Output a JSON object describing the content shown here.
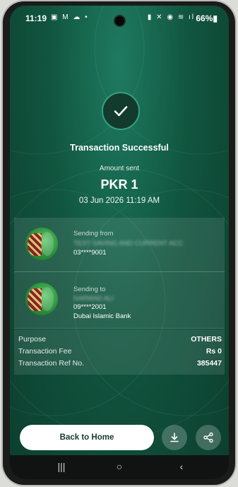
{
  "status_bar": {
    "time": "11:19",
    "left_icons": "▣ M ☁ •",
    "right_icons": "▮ ✕ ◉ ≋ ıl",
    "battery": "66%▮"
  },
  "header": {
    "title": "Transaction Successful",
    "amount_label": "Amount sent",
    "amount": "PKR 1",
    "datetime": "03 Jun 2026 11:19 AM"
  },
  "sender": {
    "label": "Sending from",
    "name": "TEST SAVING AND CURRENT ACC",
    "account": "03****9001"
  },
  "recipient": {
    "label": "Sending to",
    "name": "SARMAD ALI",
    "account": "09****2001",
    "bank": "Dubai Islamic Bank"
  },
  "details": [
    {
      "label": "Purpose",
      "value": "OTHERS"
    },
    {
      "label": "Transaction Fee",
      "value": "Rs 0"
    },
    {
      "label": "Transaction Ref No.",
      "value": "385447"
    }
  ],
  "actions": {
    "home_label": "Back to Home",
    "download_icon": "download-icon",
    "share_icon": "share-icon"
  },
  "nav": {
    "recents": "|||",
    "home": "○",
    "back": "‹"
  },
  "colors": {
    "accent": "#35a07f",
    "background": "#11553f"
  }
}
